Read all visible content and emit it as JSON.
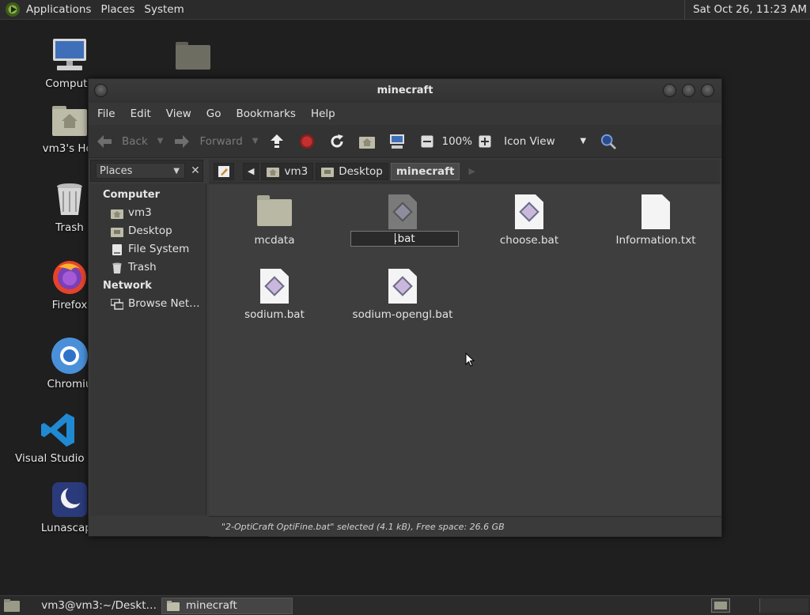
{
  "top_panel": {
    "menus": [
      "Applications",
      "Places",
      "System"
    ],
    "clock": "Sat Oct 26, 11:23 AM"
  },
  "desktop": {
    "icons": [
      "Compute",
      "vm3's Hor",
      "Trash",
      "Firefox",
      "Chromiu",
      "Visual Studio Co",
      "Lunascape"
    ]
  },
  "window": {
    "title": "minecraft",
    "menu": [
      "File",
      "Edit",
      "View",
      "Go",
      "Bookmarks",
      "Help"
    ],
    "toolbar": {
      "back": "Back",
      "forward": "Forward",
      "zoom": "100%",
      "view_mode": "Icon View"
    },
    "sidebar": {
      "selector": "Places",
      "sections": [
        {
          "title": "Computer",
          "items": [
            "vm3",
            "Desktop",
            "File System",
            "Trash"
          ]
        },
        {
          "title": "Network",
          "items": [
            "Browse Net…"
          ]
        }
      ]
    },
    "path": [
      "vm3",
      "Desktop",
      "minecraft"
    ],
    "files": [
      {
        "name": "mcdata",
        "type": "folder"
      },
      {
        "name": ".bat",
        "type": "bat-renaming"
      },
      {
        "name": "choose.bat",
        "type": "bat"
      },
      {
        "name": "Information.txt",
        "type": "txt"
      },
      {
        "name": "sodium.bat",
        "type": "bat"
      },
      {
        "name": "sodium-opengl.bat",
        "type": "bat"
      }
    ],
    "status": "\"2-OptiCraft OptiFine.bat\" selected (4.1 kB), Free space: 26.6 GB"
  },
  "taskbar": {
    "tasks": [
      "vm3@vm3:~/Deskt…",
      "minecraft"
    ]
  },
  "colors": {
    "panel_bg": "#2b2b2b",
    "window_bg": "#3e3e3e",
    "folder": "#b9b8a4"
  }
}
